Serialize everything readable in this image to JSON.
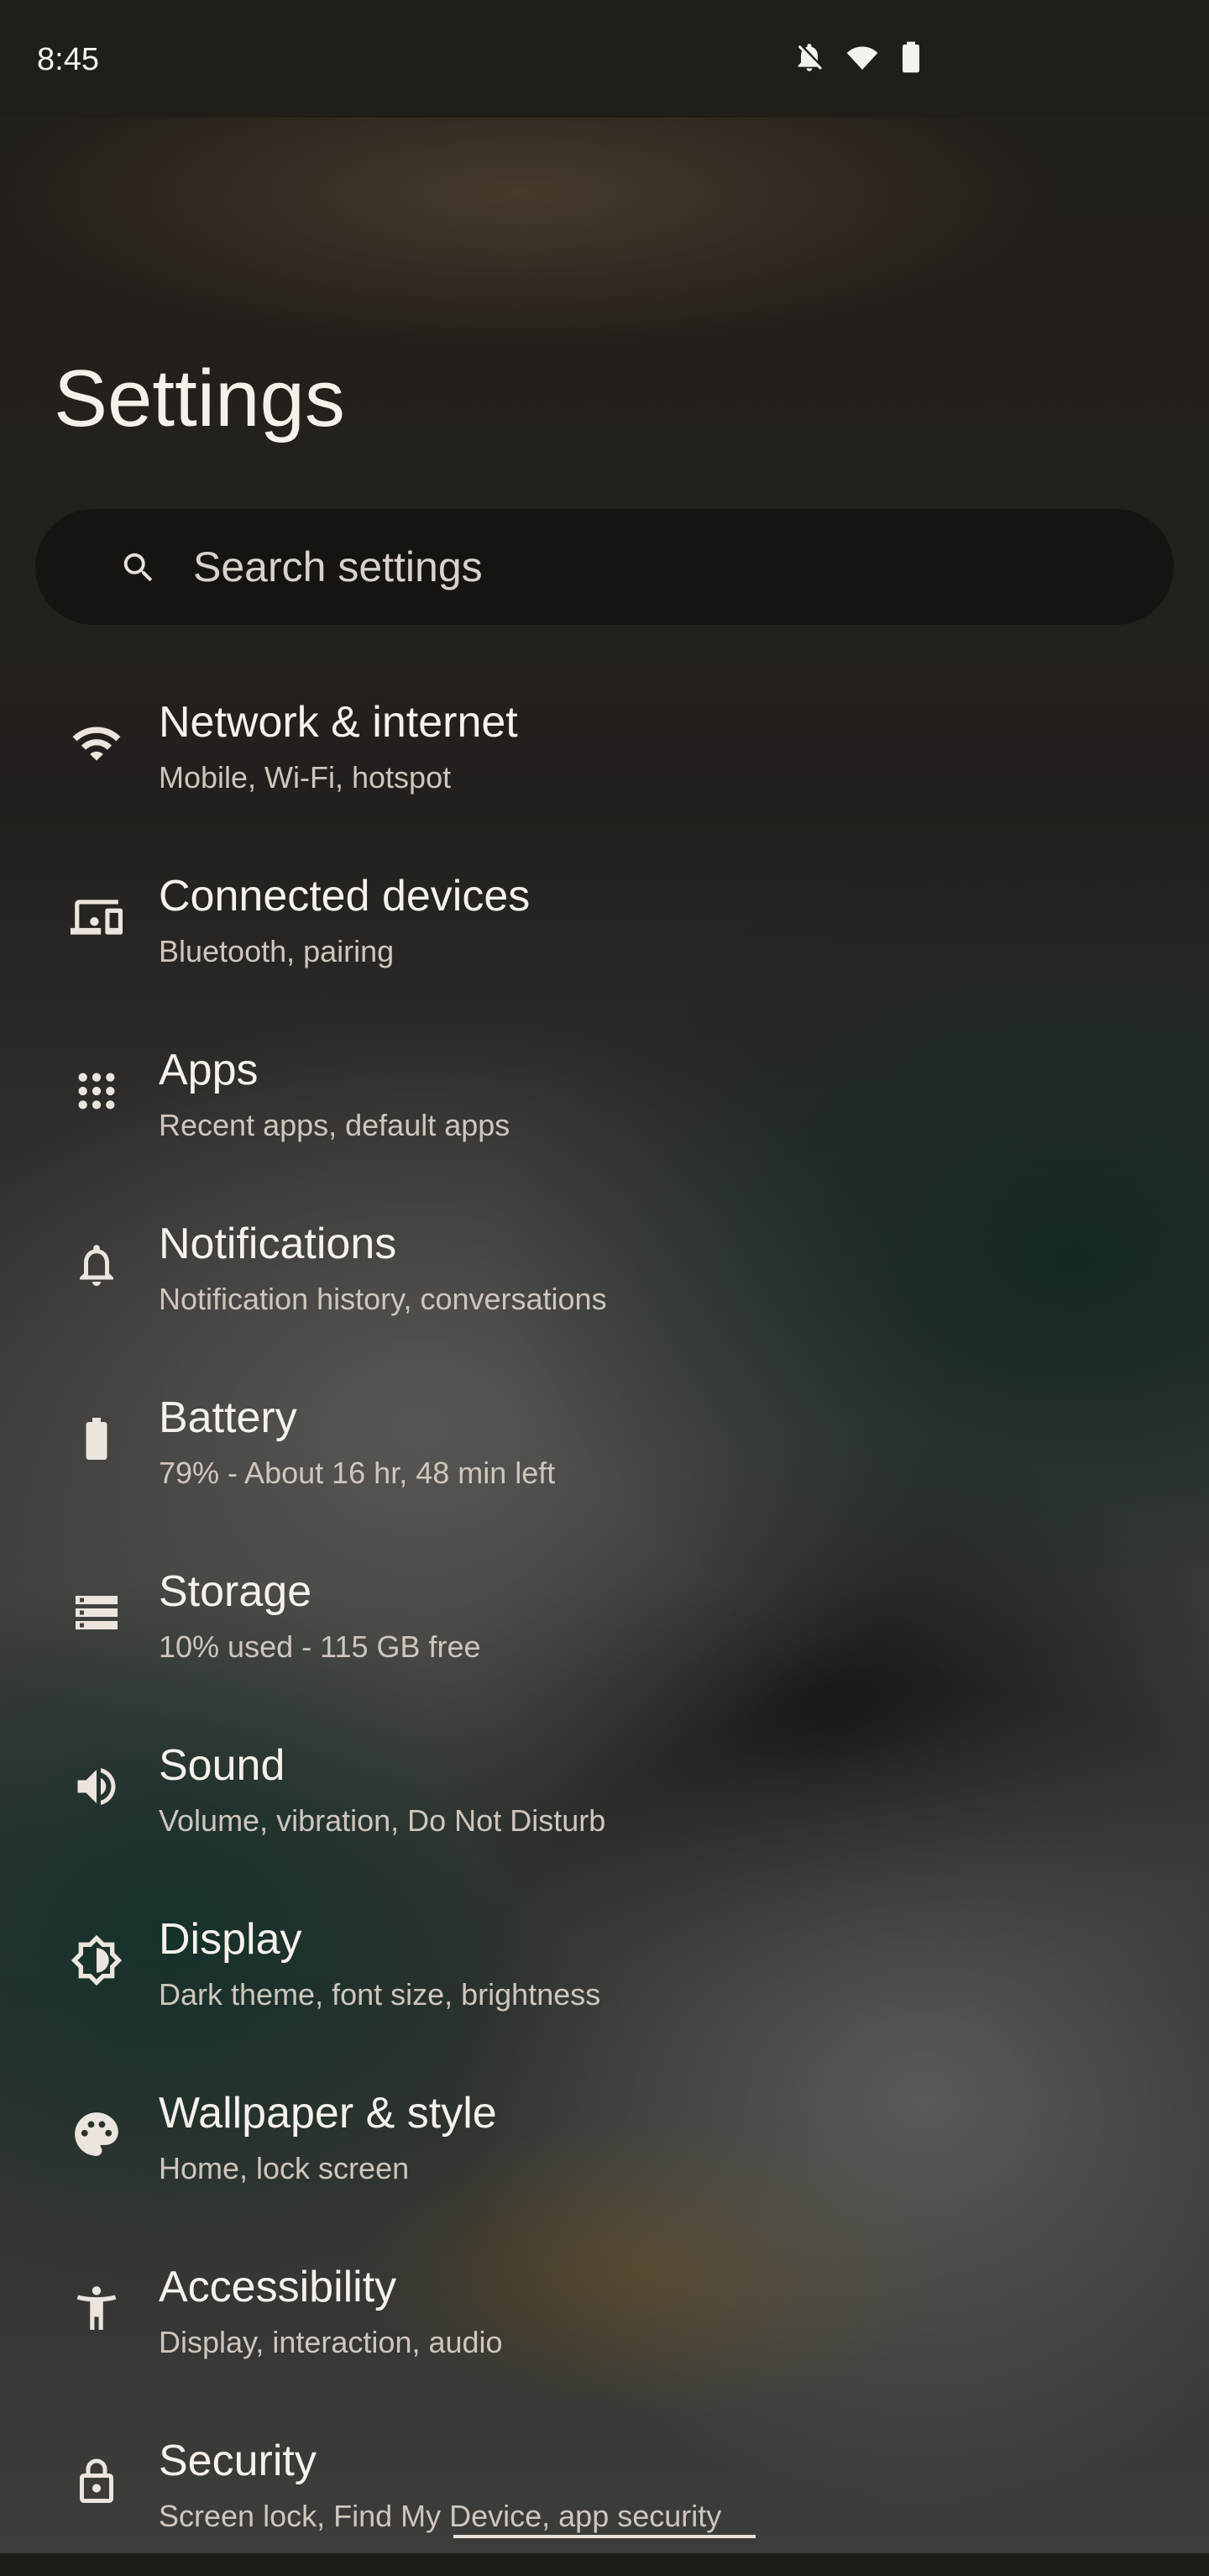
{
  "status_bar": {
    "time": "8:45",
    "icons": [
      "notifications-off-icon",
      "wifi-icon",
      "battery-icon"
    ]
  },
  "page": {
    "title": "Settings"
  },
  "search": {
    "placeholder": "Search settings"
  },
  "menu": {
    "items": [
      {
        "title": "Network & internet",
        "subtitle": "Mobile, Wi‑Fi, hotspot",
        "icon": "wifi-icon"
      },
      {
        "title": "Connected devices",
        "subtitle": "Bluetooth, pairing",
        "icon": "devices-icon"
      },
      {
        "title": "Apps",
        "subtitle": "Recent apps, default apps",
        "icon": "apps-grid-icon"
      },
      {
        "title": "Notifications",
        "subtitle": "Notification history, conversations",
        "icon": "bell-icon"
      },
      {
        "title": "Battery",
        "subtitle": "79% - About 16 hr, 48 min left",
        "icon": "battery-icon"
      },
      {
        "title": "Storage",
        "subtitle": "10% used - 115 GB free",
        "icon": "storage-icon"
      },
      {
        "title": "Sound",
        "subtitle": "Volume, vibration, Do Not Disturb",
        "icon": "speaker-icon"
      },
      {
        "title": "Display",
        "subtitle": "Dark theme, font size, brightness",
        "icon": "brightness-icon"
      },
      {
        "title": "Wallpaper & style",
        "subtitle": "Home, lock screen",
        "icon": "palette-icon"
      },
      {
        "title": "Accessibility",
        "subtitle": "Display, interaction, audio",
        "icon": "accessibility-icon"
      },
      {
        "title": "Security",
        "subtitle": "Screen lock, Find My Device, app security",
        "icon": "lock-icon"
      }
    ]
  },
  "colors": {
    "text_primary": "#f6f1eb",
    "text_secondary": "#cfc6bd",
    "status_bar_bg": "#211e19",
    "search_bg": "#141210"
  }
}
